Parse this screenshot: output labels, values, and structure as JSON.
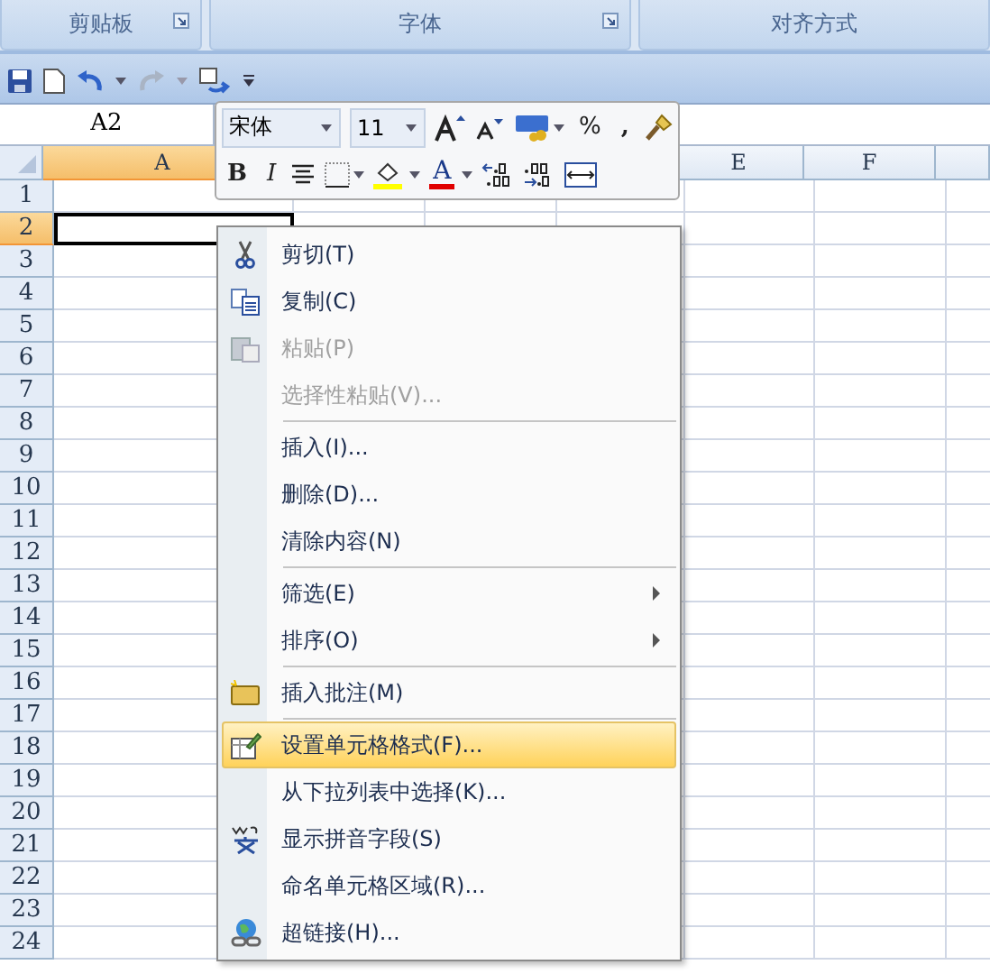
{
  "ribbon_groups": [
    {
      "label": "剪贴板",
      "launcher": true
    },
    {
      "label": "字体",
      "launcher": true
    },
    {
      "label": "对齐方式",
      "launcher": false
    }
  ],
  "name_box": {
    "value": "A2"
  },
  "mini_toolbar": {
    "font": "宋体",
    "size": "11",
    "percent": "%",
    "comma": ",",
    "bold": "B",
    "italic": "I",
    "font_color": "A"
  },
  "columns": [
    {
      "label": "A",
      "selected": true
    },
    {
      "label": "E",
      "selected": false
    },
    {
      "label": "F",
      "selected": false
    }
  ],
  "rows": [
    {
      "label": "1",
      "selected": false
    },
    {
      "label": "2",
      "selected": true
    },
    {
      "label": "3",
      "selected": false
    },
    {
      "label": "4",
      "selected": false
    },
    {
      "label": "5",
      "selected": false
    },
    {
      "label": "6",
      "selected": false
    },
    {
      "label": "7",
      "selected": false
    },
    {
      "label": "8",
      "selected": false
    },
    {
      "label": "9",
      "selected": false
    },
    {
      "label": "10",
      "selected": false
    },
    {
      "label": "11",
      "selected": false
    },
    {
      "label": "12",
      "selected": false
    },
    {
      "label": "13",
      "selected": false
    },
    {
      "label": "14",
      "selected": false
    },
    {
      "label": "15",
      "selected": false
    },
    {
      "label": "16",
      "selected": false
    },
    {
      "label": "17",
      "selected": false
    },
    {
      "label": "18",
      "selected": false
    },
    {
      "label": "19",
      "selected": false
    },
    {
      "label": "20",
      "selected": false
    },
    {
      "label": "21",
      "selected": false
    },
    {
      "label": "22",
      "selected": false
    },
    {
      "label": "23",
      "selected": false
    },
    {
      "label": "24",
      "selected": false
    }
  ],
  "context_menu": {
    "items": [
      {
        "kind": "item",
        "label": "剪切(T)",
        "disabled": false,
        "selected": false,
        "submenu": false
      },
      {
        "kind": "item",
        "label": "复制(C)",
        "disabled": false,
        "selected": false,
        "submenu": false
      },
      {
        "kind": "item",
        "label": "粘贴(P)",
        "disabled": true,
        "selected": false,
        "submenu": false
      },
      {
        "kind": "item",
        "label": "选择性粘贴(V)...",
        "disabled": true,
        "selected": false,
        "submenu": false
      },
      {
        "kind": "separator"
      },
      {
        "kind": "item",
        "label": "插入(I)...",
        "disabled": false,
        "selected": false,
        "submenu": false
      },
      {
        "kind": "item",
        "label": "删除(D)...",
        "disabled": false,
        "selected": false,
        "submenu": false
      },
      {
        "kind": "item",
        "label": "清除内容(N)",
        "disabled": false,
        "selected": false,
        "submenu": false
      },
      {
        "kind": "separator"
      },
      {
        "kind": "item",
        "label": "筛选(E)",
        "disabled": false,
        "selected": false,
        "submenu": true
      },
      {
        "kind": "item",
        "label": "排序(O)",
        "disabled": false,
        "selected": false,
        "submenu": true
      },
      {
        "kind": "separator"
      },
      {
        "kind": "item",
        "label": "插入批注(M)",
        "disabled": false,
        "selected": false,
        "submenu": false
      },
      {
        "kind": "separator"
      },
      {
        "kind": "item",
        "label": "设置单元格格式(F)...",
        "disabled": false,
        "selected": true,
        "submenu": false
      },
      {
        "kind": "item",
        "label": "从下拉列表中选择(K)...",
        "disabled": false,
        "selected": false,
        "submenu": false
      },
      {
        "kind": "item",
        "label": "显示拼音字段(S)",
        "disabled": false,
        "selected": false,
        "submenu": false
      },
      {
        "kind": "item",
        "label": "命名单元格区域(R)...",
        "disabled": false,
        "selected": false,
        "submenu": false
      },
      {
        "kind": "item",
        "label": "超链接(H)...",
        "disabled": false,
        "selected": false,
        "submenu": false
      }
    ]
  }
}
